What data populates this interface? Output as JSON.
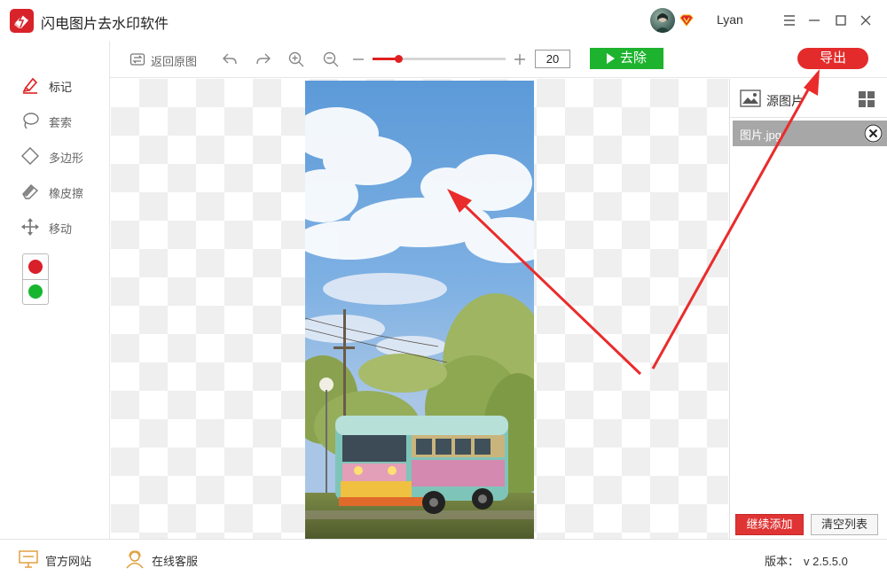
{
  "app": {
    "title": "闪电图片去水印软件",
    "user": "Lyan",
    "icons": {
      "logo": "lightning-eraser-logo",
      "vip": "vip-badge-icon",
      "menu": "hamburger-menu-icon",
      "minimize": "minimize-icon",
      "maximize": "maximize-icon",
      "close": "close-icon"
    }
  },
  "tools": {
    "items": [
      {
        "label": "标记",
        "icon": "marker-pen-icon",
        "active": true
      },
      {
        "label": "套索",
        "icon": "lasso-icon",
        "active": false
      },
      {
        "label": "多边形",
        "icon": "polygon-icon",
        "active": false
      },
      {
        "label": "橡皮擦",
        "icon": "eraser-icon",
        "active": false
      },
      {
        "label": "移动",
        "icon": "move-arrows-icon",
        "active": false
      }
    ],
    "colors": [
      "#d9202a",
      "#18b52f"
    ]
  },
  "toolbar": {
    "restore_label": "返回原图",
    "brush_size": "20",
    "brush_level": 0.19,
    "remove_label": "去除",
    "export_label": "导出"
  },
  "right_panel": {
    "source_label": "源图片",
    "file_name": "图片.jpg",
    "continue_add_label": "继续添加",
    "clear_list_label": "清空列表"
  },
  "statusbar": {
    "website_label": "官方网站",
    "service_label": "在线客服",
    "version_label": "版本：",
    "version_value": "v 2.5.5.0"
  },
  "colors": {
    "accent_red": "#e32b2b",
    "accent_green": "#1db32e",
    "file_row_bg": "#a7a7a7"
  }
}
